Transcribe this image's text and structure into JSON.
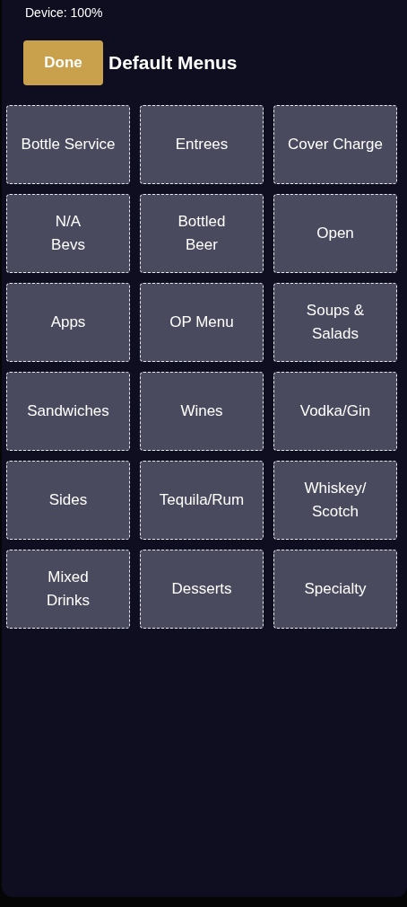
{
  "status": "Device: 100%",
  "header": {
    "button": "Done",
    "title": "Default Menus"
  },
  "tiles": [
    {
      "label": "Bottle Service"
    },
    {
      "label": "Entrees"
    },
    {
      "label": "Cover Charge"
    },
    {
      "label": "N/A\nBevs"
    },
    {
      "label": "Bottled\nBeer"
    },
    {
      "label": "Open"
    },
    {
      "label": "Apps"
    },
    {
      "label": "OP Menu"
    },
    {
      "label": "Soups &\nSalads"
    },
    {
      "label": "Sandwiches"
    },
    {
      "label": "Wines"
    },
    {
      "label": "Vodka/Gin"
    },
    {
      "label": "Sides"
    },
    {
      "label": "Tequila/Rum"
    },
    {
      "label": "Whiskey/\nScotch"
    },
    {
      "label": "Mixed\nDrinks"
    },
    {
      "label": "Desserts"
    },
    {
      "label": "Specialty"
    }
  ]
}
